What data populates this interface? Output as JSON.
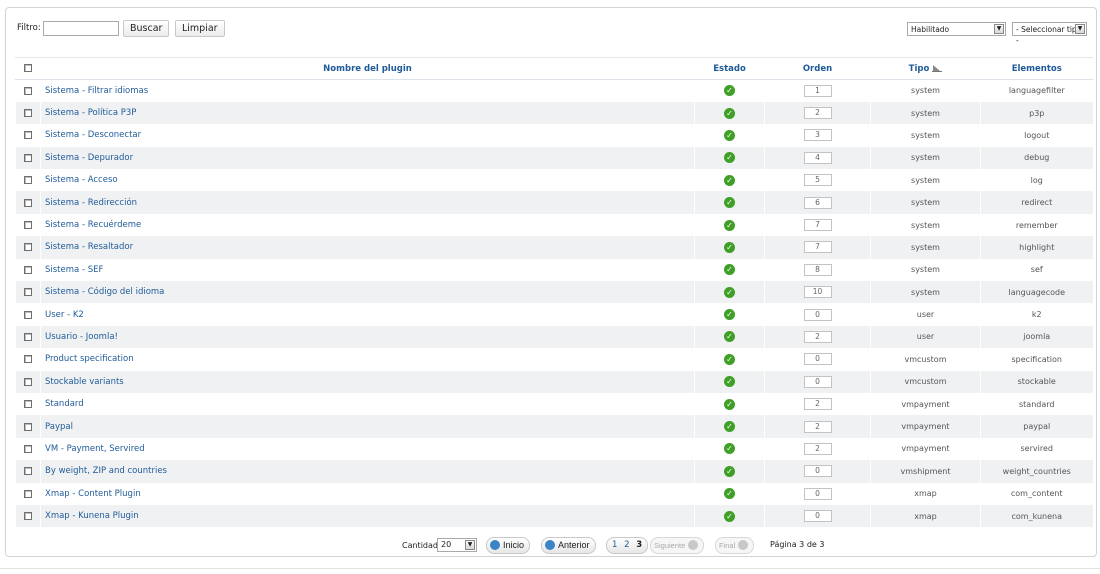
{
  "filter": {
    "label": "Filtro:",
    "value": "",
    "search_label": "Buscar",
    "clear_label": "Limpiar",
    "state_select": "Habilitado",
    "type_select": "- Seleccionar tipo -"
  },
  "table": {
    "headers": {
      "name": "Nombre del plugin",
      "status": "Estado",
      "order": "Orden",
      "type": "Tipo",
      "elements": "Elementos"
    },
    "rows": [
      {
        "name": "Sistema - Filtrar idiomas",
        "order": "1",
        "type": "system",
        "element": "languagefilter"
      },
      {
        "name": "Sistema - Política P3P",
        "order": "2",
        "type": "system",
        "element": "p3p"
      },
      {
        "name": "Sistema - Desconectar",
        "order": "3",
        "type": "system",
        "element": "logout"
      },
      {
        "name": "Sistema - Depurador",
        "order": "4",
        "type": "system",
        "element": "debug"
      },
      {
        "name": "Sistema - Acceso",
        "order": "5",
        "type": "system",
        "element": "log"
      },
      {
        "name": "Sistema - Redirección",
        "order": "6",
        "type": "system",
        "element": "redirect"
      },
      {
        "name": "Sistema - Recuérdeme",
        "order": "7",
        "type": "system",
        "element": "remember"
      },
      {
        "name": "Sistema - Resaltador",
        "order": "7",
        "type": "system",
        "element": "highlight"
      },
      {
        "name": "Sistema - SEF",
        "order": "8",
        "type": "system",
        "element": "sef"
      },
      {
        "name": "Sistema - Código del idioma",
        "order": "10",
        "type": "system",
        "element": "languagecode"
      },
      {
        "name": "User - K2",
        "order": "0",
        "type": "user",
        "element": "k2"
      },
      {
        "name": "Usuario - Joomla!",
        "order": "2",
        "type": "user",
        "element": "joomla"
      },
      {
        "name": "Product specification",
        "order": "0",
        "type": "vmcustom",
        "element": "specification"
      },
      {
        "name": "Stockable variants",
        "order": "0",
        "type": "vmcustom",
        "element": "stockable"
      },
      {
        "name": "Standard",
        "order": "2",
        "type": "vmpayment",
        "element": "standard"
      },
      {
        "name": "Paypal",
        "order": "2",
        "type": "vmpayment",
        "element": "paypal"
      },
      {
        "name": "VM - Payment, Servired",
        "order": "2",
        "type": "vmpayment",
        "element": "servired"
      },
      {
        "name": "By weight, ZIP and countries",
        "order": "0",
        "type": "vmshipment",
        "element": "weight_countries"
      },
      {
        "name": "Xmap - Content Plugin",
        "order": "0",
        "type": "xmap",
        "element": "com_content"
      },
      {
        "name": "Xmap - Kunena Plugin",
        "order": "0",
        "type": "xmap",
        "element": "com_kunena"
      }
    ]
  },
  "pagination": {
    "limit_label": "Cantidad",
    "limit_value": "20",
    "start_label": "Inicio",
    "prev_label": "Anterior",
    "pages": [
      "1",
      "2",
      "3"
    ],
    "current_page": "3",
    "next_label": "Siguiente",
    "end_label": "Final",
    "page_info": "Página 3 de 3"
  },
  "colors": {
    "link": "#1f5b98",
    "enabled": "#3f9f26",
    "row_alt": "#f0f1f3"
  },
  "icons": {
    "status": "checkmark-circle-icon",
    "sort": "sort-ascending-icon",
    "start": "first-page-icon",
    "prev": "previous-page-icon",
    "next": "next-page-icon",
    "end": "last-page-icon"
  }
}
